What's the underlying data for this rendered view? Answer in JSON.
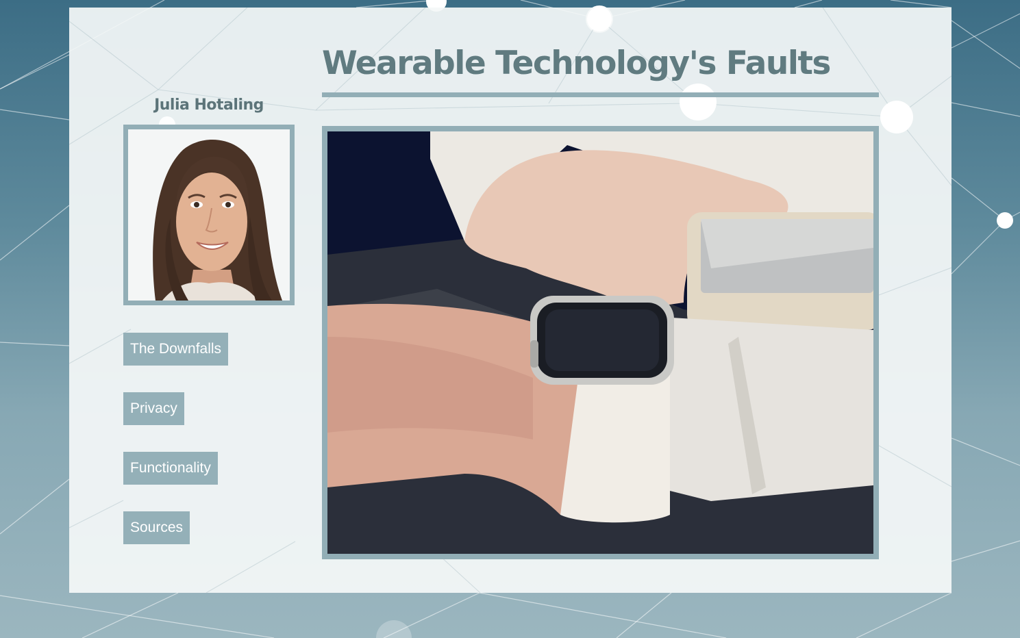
{
  "page": {
    "title": "Wearable Technology's Faults",
    "author": "Julia Hotaling"
  },
  "nav": {
    "items": [
      {
        "label": "The Downfalls"
      },
      {
        "label": "Privacy"
      },
      {
        "label": "Functionality"
      },
      {
        "label": "Sources"
      }
    ]
  },
  "images": {
    "portrait": "portrait-photo",
    "hero": "smartwatch-photo"
  },
  "colors": {
    "accent": "#92aeb6",
    "button_bg": "#94b0b8",
    "title_text": "#607b80",
    "panel_bg": "#f4f7f8",
    "page_bg_top": "#3c6d85",
    "page_bg_bottom": "#9bb6bf"
  }
}
